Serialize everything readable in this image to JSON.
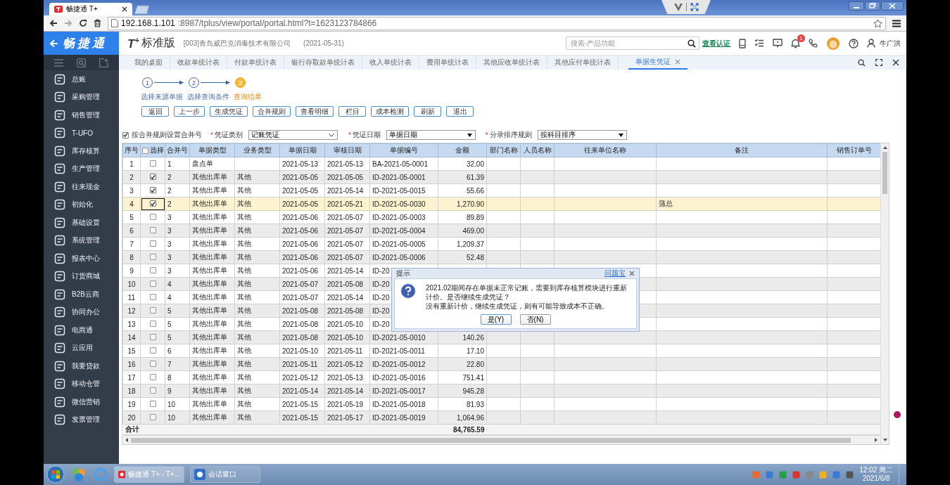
{
  "browser": {
    "tabs": [
      {
        "title": "畅捷通 T+",
        "selected": true
      }
    ],
    "url_host": "192.168.1.101",
    "url_rest": ":8987/tplus/view/portal/portal.html?t=1623123784866"
  },
  "sidebar": {
    "logo": "畅捷通",
    "items": [
      "总账",
      "采购管理",
      "销售管理",
      "T-UFO",
      "库存核算",
      "生产管理",
      "往来现金",
      "初始化",
      "基础设置",
      "系统管理",
      "报表中心",
      "订货商城",
      "B2B云商",
      "协同办公",
      "电商通",
      "云应用",
      "我要贷款",
      "移动仓管",
      "微信营销",
      "发票管理"
    ]
  },
  "header": {
    "logo_mark": "T",
    "logo_sup": "+",
    "product": "标准版",
    "company": "[003]青岛威巴克消毒技术有限公司",
    "period": "(2021-05-31)",
    "search_placeholder": "搜索-产品功能",
    "cert_link": "查看认证",
    "notification_count": "1",
    "user": "牛广洪"
  },
  "tabs": [
    {
      "label": "我的桌面",
      "selected": false
    },
    {
      "label": "收款单统计表",
      "selected": false
    },
    {
      "label": "付款单统计表",
      "selected": false
    },
    {
      "label": "银行存取款单统计表",
      "selected": false
    },
    {
      "label": "收入单统计表",
      "selected": false
    },
    {
      "label": "费用单统计表",
      "selected": false
    },
    {
      "label": "其他应收单统计表",
      "selected": false
    },
    {
      "label": "其他应付单统计表",
      "selected": false
    },
    {
      "label": "单据生凭证",
      "selected": true
    }
  ],
  "steps": [
    {
      "number": "1",
      "label": "选择来源单据",
      "current": false
    },
    {
      "number": "2",
      "label": "选择查询条件",
      "current": false
    },
    {
      "number": "3",
      "label": "查询结果",
      "current": true
    }
  ],
  "buttons": [
    "返回",
    "上一步",
    "生成凭证",
    "合并规则",
    "查看明细",
    "栏目",
    "成本检测",
    "刷新",
    "退出"
  ],
  "merge_option": {
    "label": "按合并规则设置合并号",
    "checked": true
  },
  "filters": [
    {
      "mark": "*",
      "label": "凭证类别",
      "value": "记账凭证",
      "kind": "chevron"
    },
    {
      "mark": "*",
      "label": "凭证日期",
      "value": "单据日期",
      "kind": "triangle"
    },
    {
      "mark": "*",
      "label": "分录排序规则",
      "value": "按科目排序",
      "kind": "triangle"
    }
  ],
  "table": {
    "columns": [
      "序号",
      "选择",
      "合并号",
      "单据类型",
      "业务类型",
      "单据日期",
      "审核日期",
      "单据编号",
      "金额",
      "部门名称",
      "人员名称",
      "往来单位名称",
      "备注",
      "销售订单号"
    ],
    "select_all_checked": false,
    "rows": [
      {
        "no": "1",
        "checked": false,
        "selected": false,
        "merge": "1",
        "doc_type": "盘点单",
        "doc_date": "2021-05-13",
        "audit_date": "2021-05-13",
        "doc_no": "BA-2021-05-0001",
        "amount": "32.00"
      },
      {
        "no": "2",
        "checked": true,
        "selected": false,
        "merge": "2",
        "doc_type": "其他出库单",
        "biz_type": "其他",
        "doc_date": "2021-05-05",
        "audit_date": "2021-05-05",
        "doc_no": "ID-2021-05-0001",
        "amount": "61.39"
      },
      {
        "no": "3",
        "checked": true,
        "selected": false,
        "merge": "2",
        "doc_type": "其他出库单",
        "biz_type": "其他",
        "doc_date": "2021-05-05",
        "audit_date": "2021-05-14",
        "doc_no": "ID-2021-05-0015",
        "amount": "55.66"
      },
      {
        "no": "4",
        "checked": true,
        "selected": true,
        "merge": "2",
        "doc_type": "其他出库单",
        "biz_type": "其他",
        "doc_date": "2021-05-05",
        "audit_date": "2021-05-21",
        "doc_no": "ID-2021-05-0030",
        "amount": "1,270.90",
        "remark": "蒲总"
      },
      {
        "no": "5",
        "checked": false,
        "selected": false,
        "merge": "3",
        "doc_type": "其他出库单",
        "biz_type": "其他",
        "doc_date": "2021-05-06",
        "audit_date": "2021-05-07",
        "doc_no": "ID-2021-05-0003",
        "amount": "89.89"
      },
      {
        "no": "6",
        "checked": false,
        "selected": false,
        "merge": "3",
        "doc_type": "其他出库单",
        "biz_type": "其他",
        "doc_date": "2021-05-06",
        "audit_date": "2021-05-07",
        "doc_no": "ID-2021-05-0004",
        "amount": "469.00"
      },
      {
        "no": "7",
        "checked": false,
        "selected": false,
        "merge": "3",
        "doc_type": "其他出库单",
        "biz_type": "其他",
        "doc_date": "2021-05-06",
        "audit_date": "2021-05-07",
        "doc_no": "ID-2021-05-0005",
        "amount": "1,209.37"
      },
      {
        "no": "8",
        "checked": false,
        "selected": false,
        "merge": "3",
        "doc_type": "其他出库单",
        "biz_type": "其他",
        "doc_date": "2021-05-06",
        "audit_date": "2021-05-07",
        "doc_no": "ID-2021-05-0006",
        "amount": "52.48"
      },
      {
        "no": "9",
        "checked": false,
        "selected": false,
        "merge": "3",
        "doc_type": "其他出库单",
        "biz_type": "其他",
        "doc_date": "2021-05-06",
        "audit_date": "2021-05-14",
        "doc_no": "ID-20"
      },
      {
        "no": "10",
        "checked": false,
        "selected": false,
        "merge": "4",
        "doc_type": "其他出库单",
        "biz_type": "其他",
        "doc_date": "2021-05-07",
        "audit_date": "2021-05-08",
        "doc_no": "ID-20"
      },
      {
        "no": "11",
        "checked": false,
        "selected": false,
        "merge": "4",
        "doc_type": "其他出库单",
        "biz_type": "其他",
        "doc_date": "2021-05-07",
        "audit_date": "2021-05-14",
        "doc_no": "ID-20"
      },
      {
        "no": "12",
        "checked": false,
        "selected": false,
        "merge": "5",
        "doc_type": "其他出库单",
        "biz_type": "其他",
        "doc_date": "2021-05-08",
        "audit_date": "2021-05-08",
        "doc_no": "ID-20"
      },
      {
        "no": "13",
        "checked": false,
        "selected": false,
        "merge": "5",
        "doc_type": "其他出库单",
        "biz_type": "其他",
        "doc_date": "2021-05-08",
        "audit_date": "2021-05-10",
        "doc_no": "ID-20"
      },
      {
        "no": "14",
        "checked": false,
        "selected": false,
        "merge": "5",
        "doc_type": "其他出库单",
        "biz_type": "其他",
        "doc_date": "2021-05-08",
        "audit_date": "2021-05-10",
        "doc_no": "ID-2021-05-0010",
        "amount": "140.26"
      },
      {
        "no": "15",
        "checked": false,
        "selected": false,
        "merge": "6",
        "doc_type": "其他出库单",
        "biz_type": "其他",
        "doc_date": "2021-05-10",
        "audit_date": "2021-05-11",
        "doc_no": "ID-2021-05-0011",
        "amount": "17.10"
      },
      {
        "no": "16",
        "checked": false,
        "selected": false,
        "merge": "7",
        "doc_type": "其他出库单",
        "biz_type": "其他",
        "doc_date": "2021-05-11",
        "audit_date": "2021-05-12",
        "doc_no": "ID-2021-05-0012",
        "amount": "22.80"
      },
      {
        "no": "17",
        "checked": false,
        "selected": false,
        "merge": "8",
        "doc_type": "其他出库单",
        "biz_type": "其他",
        "doc_date": "2021-05-12",
        "audit_date": "2021-05-13",
        "doc_no": "ID-2021-05-0016",
        "amount": "751.41"
      },
      {
        "no": "18",
        "checked": false,
        "selected": false,
        "merge": "9",
        "doc_type": "其他出库单",
        "biz_type": "其他",
        "doc_date": "2021-05-14",
        "audit_date": "2021-05-14",
        "doc_no": "ID-2021-05-0017",
        "amount": "945.28"
      },
      {
        "no": "19",
        "checked": false,
        "selected": false,
        "merge": "10",
        "doc_type": "其他出库单",
        "biz_type": "其他",
        "doc_date": "2021-05-15",
        "audit_date": "2021-05-19",
        "doc_no": "ID-2021-05-0018",
        "amount": "81.93"
      },
      {
        "no": "20",
        "checked": false,
        "selected": false,
        "merge": "10",
        "doc_type": "其他出库单",
        "biz_type": "其他",
        "doc_date": "2021-05-15",
        "audit_date": "2021-05-17",
        "doc_no": "ID-2021-05-0019",
        "amount": "1,064.96"
      }
    ],
    "total": {
      "label": "合计",
      "amount": "84,765.59"
    }
  },
  "dialog": {
    "title": "提示",
    "help_link": "问题宝",
    "message": [
      "2021.02期间存在单据未正常记账，需要到库存核算模块进行重新计价。是否继续生成凭证？",
      "没有重新计价，继续生成凭证，则有可能导致成本不正确。"
    ],
    "buttons": [
      {
        "label": "是(Y)",
        "default": true
      },
      {
        "label": "否(N)",
        "default": false
      }
    ]
  },
  "taskbar": {
    "tasks": [
      {
        "label": "畅捷通 T+ - T+...",
        "selected": true
      },
      {
        "label": "会话窗口",
        "selected": false
      }
    ],
    "time": "12:02 周二",
    "date": "2021/6/8"
  }
}
